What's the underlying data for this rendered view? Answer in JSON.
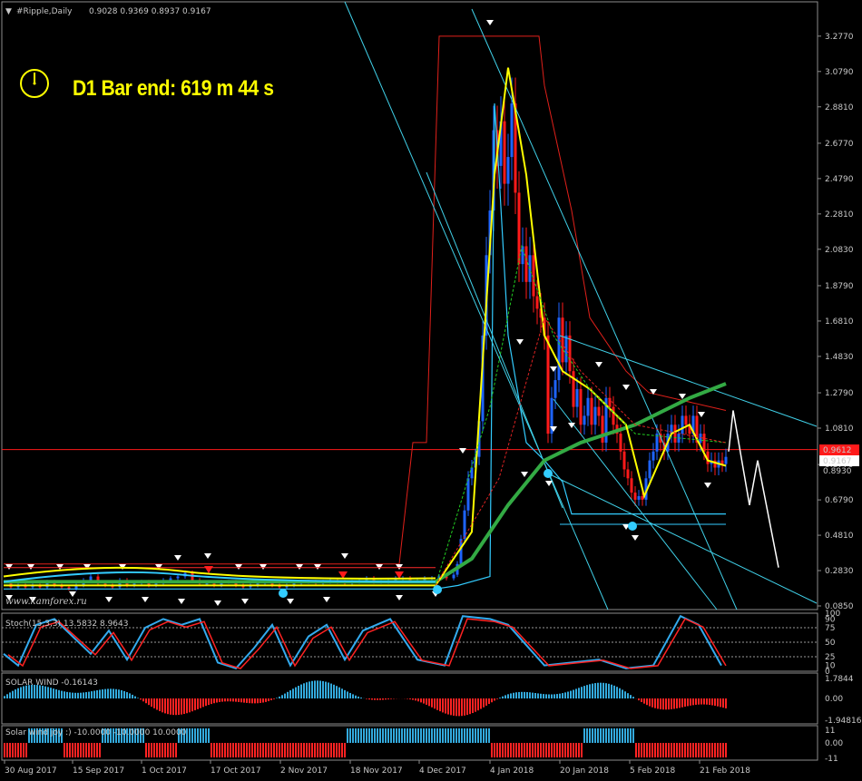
{
  "window": {
    "title": "#Ripple,Daily",
    "ohlc": "0.9028 0.9369 0.8937 0.9167"
  },
  "timer_text": "D1 Bar end: 619 m 44 s",
  "watermark": "www.kamforex.ru",
  "price_tags": {
    "bid_line": "0.9612",
    "current": "0.9167",
    "extra": "0.8930"
  },
  "colors": {
    "background": "#000000",
    "bull": "#1e64ff",
    "bear": "#ff1a1a",
    "cyan": "#33ccff",
    "yellow": "#ffff00",
    "green": "#22aa33"
  },
  "chart_data": [
    {
      "type": "line",
      "name": "main",
      "title": "#Ripple,Daily",
      "x": [
        "30 Aug 2017",
        "15 Sep 2017",
        "1 Oct 2017",
        "17 Oct 2017",
        "2 Nov 2017",
        "18 Nov 2017",
        "4 Dec 2017",
        "4 Jan 2018",
        "20 Jan 2018",
        "5 Feb 2018",
        "21 Feb 2018"
      ],
      "y_ticks": [
        "3.2770",
        "3.0790",
        "2.8810",
        "2.6770",
        "2.4790",
        "2.2810",
        "2.0830",
        "1.8790",
        "1.6810",
        "1.4830",
        "1.2790",
        "1.0810",
        "0.8770",
        "0.6790",
        "0.4810",
        "0.2830",
        "0.0850"
      ],
      "ylim": [
        0.085,
        3.327
      ],
      "close_series": [
        [
          0,
          0.21
        ],
        [
          8,
          0.19
        ],
        [
          16,
          0.2
        ],
        [
          24,
          0.19
        ],
        [
          32,
          0.2
        ],
        [
          40,
          0.19
        ],
        [
          48,
          0.22
        ],
        [
          56,
          0.2
        ],
        [
          64,
          0.19
        ],
        [
          72,
          0.18
        ],
        [
          80,
          0.2
        ],
        [
          88,
          0.23
        ],
        [
          96,
          0.25
        ],
        [
          104,
          0.21
        ],
        [
          112,
          0.2
        ],
        [
          120,
          0.19
        ],
        [
          128,
          0.23
        ],
        [
          136,
          0.2
        ],
        [
          144,
          0.21
        ],
        [
          152,
          0.22
        ],
        [
          160,
          0.2
        ],
        [
          168,
          0.21
        ],
        [
          176,
          0.23
        ],
        [
          184,
          0.24
        ],
        [
          192,
          0.25
        ],
        [
          200,
          0.27
        ],
        [
          208,
          0.23
        ],
        [
          216,
          0.21
        ],
        [
          224,
          0.21
        ],
        [
          232,
          0.2
        ],
        [
          240,
          0.22
        ],
        [
          248,
          0.22
        ],
        [
          256,
          0.2
        ],
        [
          264,
          0.19
        ],
        [
          272,
          0.2
        ],
        [
          280,
          0.21
        ],
        [
          288,
          0.22
        ],
        [
          296,
          0.2
        ],
        [
          304,
          0.19
        ],
        [
          312,
          0.2
        ],
        [
          320,
          0.21
        ],
        [
          328,
          0.22
        ],
        [
          336,
          0.22
        ],
        [
          344,
          0.21
        ],
        [
          352,
          0.22
        ],
        [
          360,
          0.23
        ],
        [
          368,
          0.22
        ],
        [
          376,
          0.21
        ],
        [
          384,
          0.22
        ],
        [
          392,
          0.23
        ],
        [
          400,
          0.24
        ],
        [
          408,
          0.22
        ],
        [
          416,
          0.22
        ],
        [
          424,
          0.23
        ],
        [
          432,
          0.24
        ],
        [
          440,
          0.24
        ],
        [
          448,
          0.23
        ],
        [
          456,
          0.23
        ],
        [
          464,
          0.24
        ],
        [
          472,
          0.24
        ],
        [
          480,
          0.25
        ],
        [
          488,
          0.24
        ],
        [
          496,
          0.26
        ],
        [
          500,
          0.32
        ],
        [
          504,
          0.46
        ],
        [
          508,
          0.62
        ],
        [
          512,
          0.8
        ],
        [
          516,
          0.86
        ],
        [
          520,
          0.92
        ],
        [
          524,
          1.12
        ],
        [
          528,
          1.6
        ],
        [
          532,
          2.05
        ],
        [
          536,
          2.3
        ],
        [
          540,
          2.75
        ],
        [
          544,
          2.55
        ],
        [
          548,
          2.8
        ],
        [
          552,
          2.45
        ],
        [
          556,
          2.6
        ],
        [
          560,
          2.9
        ],
        [
          564,
          2.4
        ],
        [
          568,
          2.0
        ],
        [
          572,
          2.1
        ],
        [
          576,
          1.9
        ],
        [
          580,
          2.05
        ],
        [
          584,
          1.82
        ],
        [
          588,
          1.75
        ],
        [
          592,
          1.7
        ],
        [
          596,
          1.6
        ],
        [
          600,
          1.05
        ],
        [
          604,
          1.25
        ],
        [
          608,
          1.35
        ],
        [
          612,
          1.7
        ],
        [
          616,
          1.45
        ],
        [
          620,
          1.6
        ],
        [
          624,
          1.4
        ],
        [
          628,
          1.2
        ],
        [
          632,
          1.3
        ],
        [
          636,
          1.1
        ],
        [
          640,
          1.15
        ],
        [
          644,
          1.25
        ],
        [
          648,
          1.1
        ],
        [
          652,
          1.2
        ],
        [
          656,
          1.15
        ],
        [
          660,
          1.0
        ],
        [
          664,
          1.25
        ],
        [
          668,
          1.2
        ],
        [
          672,
          1.1
        ],
        [
          676,
          1.05
        ],
        [
          680,
          0.95
        ],
        [
          684,
          0.85
        ],
        [
          688,
          0.8
        ],
        [
          692,
          0.72
        ],
        [
          696,
          0.68
        ],
        [
          700,
          0.7
        ],
        [
          704,
          0.68
        ],
        [
          708,
          0.8
        ],
        [
          712,
          0.9
        ],
        [
          716,
          0.95
        ],
        [
          720,
          1.05
        ],
        [
          724,
          1.0
        ],
        [
          728,
          0.95
        ],
        [
          732,
          1.05
        ],
        [
          736,
          1.1
        ],
        [
          740,
          1.0
        ],
        [
          744,
          1.05
        ],
        [
          748,
          1.15
        ],
        [
          752,
          1.1
        ],
        [
          756,
          1.05
        ],
        [
          760,
          1.15
        ],
        [
          764,
          1.0
        ],
        [
          768,
          1.05
        ],
        [
          772,
          0.95
        ],
        [
          776,
          0.88
        ],
        [
          780,
          0.9
        ],
        [
          784,
          0.86
        ],
        [
          788,
          0.9
        ],
        [
          792,
          0.88
        ],
        [
          796,
          0.92
        ]
      ]
    },
    {
      "type": "line",
      "name": "stoch",
      "title": "Stoch(15,3,3) 13.5832 8.9643",
      "y_ticks": [
        "100",
        "90",
        "75",
        "50",
        "25",
        "10",
        "0"
      ],
      "ylim": [
        0,
        100
      ]
    },
    {
      "type": "bar",
      "name": "solar-wind",
      "title": "SOLAR WIND -0.16143",
      "y_ticks": [
        "1.7844",
        "0.00",
        "-1.94816"
      ],
      "ylim": [
        -1.94816,
        1.7844
      ]
    },
    {
      "type": "bar",
      "name": "solar-wind-joy",
      "title": "Solar wind joy :) -10.0000 -10.0000 10.0000",
      "y_ticks": [
        "11",
        "0.00",
        "-11"
      ],
      "ylim": [
        -11,
        11
      ]
    }
  ]
}
